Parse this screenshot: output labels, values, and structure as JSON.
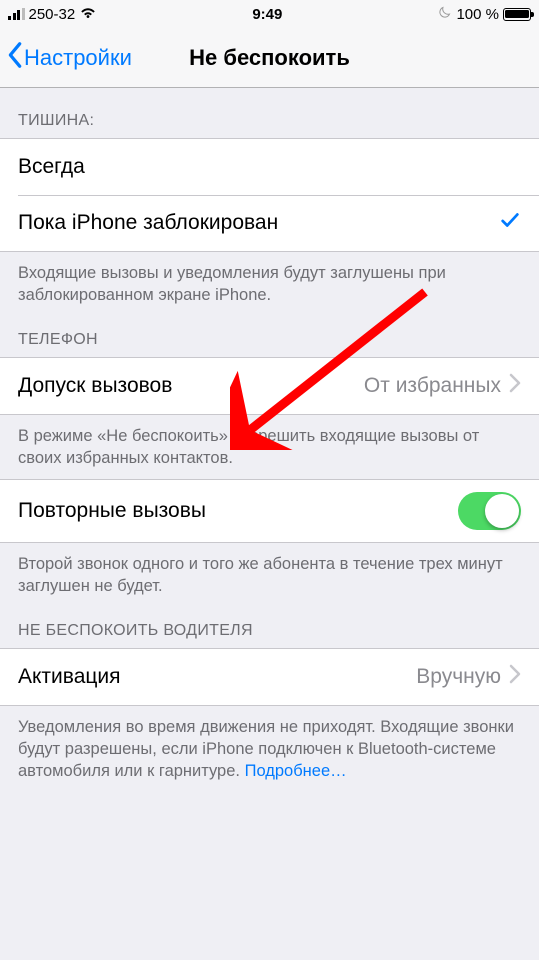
{
  "status": {
    "carrier": "250-32",
    "time": "9:49",
    "battery_pct": "100 %"
  },
  "nav": {
    "back_label": "Настройки",
    "title": "Не беспокоить"
  },
  "section_silence": {
    "header": "ТИШИНА:",
    "option_always": "Всегда",
    "option_locked": "Пока iPhone заблокирован",
    "footer": "Входящие вызовы и уведомления будут заглушены при заблокированном экране iPhone."
  },
  "section_phone": {
    "header": "ТЕЛЕФОН",
    "allow_calls_label": "Допуск вызовов",
    "allow_calls_value": "От избранных",
    "allow_calls_footer": "В режиме «Не беспокоить» разрешить входящие вызовы от своих избранных контактов.",
    "repeated_label": "Повторные вызовы",
    "repeated_footer": "Второй звонок одного и того же абонента в течение трех минут заглушен не будет."
  },
  "section_driving": {
    "header": "НЕ БЕСПОКОИТЬ ВОДИТЕЛЯ",
    "activation_label": "Активация",
    "activation_value": "Вручную",
    "footer_text": "Уведомления во время движения не приходят. Входящие звонки будут разрешены, если iPhone подключен к Bluetooth-системе автомобиля или к гарнитуре. ",
    "footer_link": "Подробнее…"
  }
}
